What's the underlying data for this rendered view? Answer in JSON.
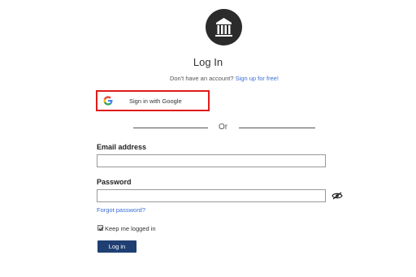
{
  "page": {
    "title": "Log In",
    "signup_prompt": "Don't have an account?",
    "signup_link": "Sign up for free!"
  },
  "google": {
    "label": "Sign in with Google",
    "icon": "google-g-icon"
  },
  "divider": {
    "text": "Or"
  },
  "email": {
    "label": "Email address",
    "value": "",
    "placeholder": ""
  },
  "password": {
    "label": "Password",
    "value": "",
    "placeholder": "",
    "toggle_icon": "eye-slash-icon"
  },
  "forgot_password": "Forgot password?",
  "keep_logged_in": {
    "label": "Keep me logged in",
    "checked": true
  },
  "login_button": "Log in",
  "logo_icon": "institution-pillars-icon",
  "colors": {
    "link": "#3a6fd6",
    "primary_button": "#1f3f73",
    "highlight_border": "#e01b1b",
    "logo_bg": "#2b2b2b"
  }
}
